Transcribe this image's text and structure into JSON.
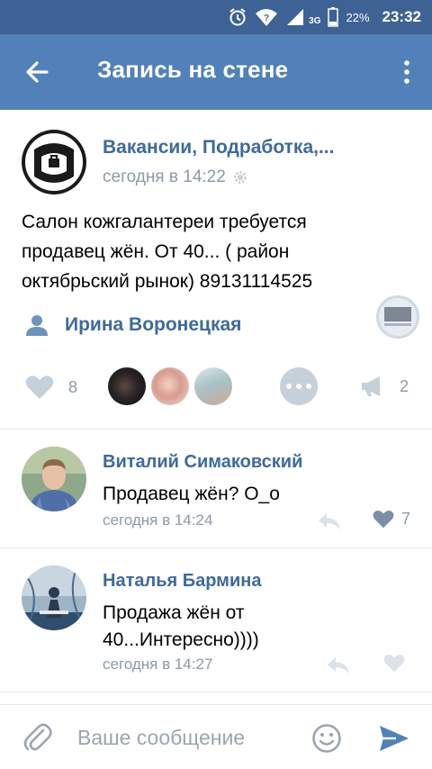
{
  "status_bar": {
    "battery_percent": "22%",
    "network_type": "3G",
    "time": "23:32",
    "icons": [
      "alarm-icon",
      "wifi-icon",
      "signal-icon",
      "battery-icon"
    ]
  },
  "toolbar": {
    "title": "Запись на стене",
    "back_icon": "arrow-left-icon",
    "menu_icon": "more-vertical-icon"
  },
  "post": {
    "author": "Вакансии, Подработка,...",
    "time": "сегодня в 14:22",
    "text": "Салон кожгалантереи требуется продавец жён. От 40... ( район октябрьский рынок) 89131114525",
    "signer": "Ирина Воронецкая",
    "likes_count": "8",
    "shares_count": "2"
  },
  "comments": [
    {
      "author": "Виталий Симаковский",
      "text": "Продавец жён? О_о",
      "time": "сегодня в 14:24",
      "likes": "7"
    },
    {
      "author": "Наталья Бармина",
      "text": "Продажа жён от 40...Интересно))))",
      "time": "сегодня в 14:27",
      "likes": ""
    }
  ],
  "input": {
    "placeholder": "Ваше сообщение",
    "value": ""
  },
  "colors": {
    "status_bar": "#3f6294",
    "toolbar": "#5181b8",
    "link": "#3e6a9a",
    "secondary_text": "#8c9aa8",
    "icon_gray": "#c6d0da",
    "send": "#5181b8"
  }
}
